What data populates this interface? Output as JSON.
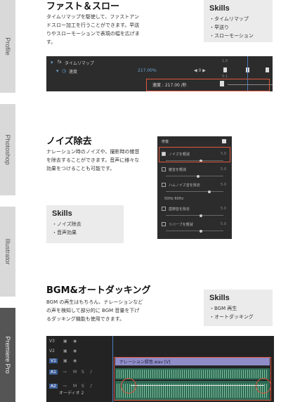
{
  "side_tabs": [
    {
      "label": "Profile"
    },
    {
      "label": "Photoshop"
    },
    {
      "label": "Illustrator"
    },
    {
      "label": "Premiere Pro"
    }
  ],
  "section1": {
    "title": "ファスト＆スロー",
    "desc": [
      "タイムリマップを駆使して、ファストアン",
      "ドスロー加工を行うことができます。早送",
      "りやスローモーションで表現の幅を広げま",
      "す。"
    ],
    "skills_head": "Skills",
    "skills": [
      "・タイムリマップ",
      "・早送り",
      "・スローモーション"
    ],
    "panel": {
      "row1_label": "タイムリマップ",
      "row2_label": "速度",
      "row2_value": "217.00%",
      "row2_nav": "◀ 0 ▶",
      "tooltip": "速度 : 217.00 /秒",
      "ticks": [
        "0.1",
        "1.0",
        "0.8"
      ]
    }
  },
  "section2": {
    "title": "ノイズ除去",
    "desc": [
      "ナレーション時のノイズや、撮影時の雑音",
      "を除去することができます。音声に様々な",
      "効果をつけることも可能です。"
    ],
    "skills_head": "Skills",
    "skills": [
      "・ノイズ除去",
      "・音声効果"
    ],
    "panel": {
      "header": "修復",
      "rows": [
        {
          "label": "ノイズを軽減",
          "value": "5.0",
          "on": true
        },
        {
          "label": "雑音を軽減",
          "value": "5.0",
          "on": false
        },
        {
          "label": "ハムノイズ音を除去",
          "value": "5.0",
          "on": false
        },
        {
          "label": "50Hz  60Hz",
          "value": "",
          "on": false
        },
        {
          "label": "歯擦音を除去",
          "value": "5.0",
          "on": false
        },
        {
          "label": "リバーブを軽減",
          "value": "5.0",
          "on": false
        }
      ]
    }
  },
  "section3": {
    "title": "BGM&オートダッキング",
    "desc": [
      "BGM の再生はもちろん、ナレーションなど",
      "の声を検知して部分的に BGM 音量を下げ",
      "るダッキング機能も使用できます。"
    ],
    "skills_head": "Skills",
    "skills": [
      "・BGM 再生",
      "・オートダッキング"
    ],
    "panel": {
      "tracks": [
        "V3",
        "V2",
        "V1",
        "A1",
        "A2"
      ],
      "clip_label": "ナレーション録音.wav [V]",
      "track_name": "オーディオ 2"
    }
  },
  "colors": {
    "highlight": "#e0573f",
    "panel_bg": "#2c2c2c",
    "skills_bg": "#ebebeb"
  }
}
